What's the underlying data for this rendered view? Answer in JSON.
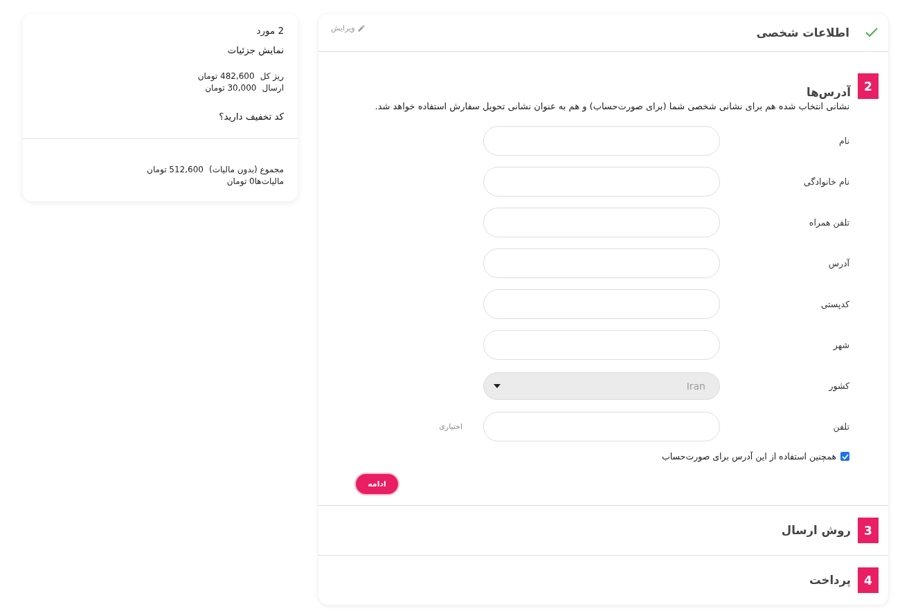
{
  "summary": {
    "items_count": "2 مورد",
    "details_link": "نمایش جزئیات",
    "lines": [
      {
        "label": "ریز کل",
        "value": "482,600 تومان"
      },
      {
        "label": "ارسال",
        "value": "30,000 تومان"
      }
    ],
    "coupon_link": "کد تخفیف دارید؟",
    "totals": [
      {
        "label": "مجموع (بدون مالیات)",
        "value": "512,600 تومان"
      },
      {
        "label": "مالیات‌ها",
        "value": "0 تومان"
      }
    ]
  },
  "steps": [
    {
      "kind": "done",
      "title": "اطلاعات شخصی",
      "edit": "ویرایش"
    },
    {
      "kind": "active",
      "number": "2",
      "title": "آدرس‌ها",
      "description": "نشانی انتخاب شده هم برای نشانی شخصی شما (برای صورت‌حساب) و هم به عنوان نشانی تحویل سفارش استفاده خواهد شد.",
      "fields": [
        {
          "kind": "text",
          "label": "نام"
        },
        {
          "kind": "text",
          "label": "نام خانوادگی"
        },
        {
          "kind": "text",
          "label": "تلفن همراه"
        },
        {
          "kind": "text",
          "label": "آدرس"
        },
        {
          "kind": "text",
          "label": "کدپستی"
        },
        {
          "kind": "text",
          "label": "شهر"
        },
        {
          "kind": "select",
          "label": "کشور",
          "value": "Iran"
        },
        {
          "kind": "text",
          "label": "تلفن",
          "hint": "اختیاری"
        }
      ],
      "checkbox": {
        "label": "همچنین استفاده از این آدرس برای صورت‌حساب",
        "checked": true
      },
      "button": "ادامه"
    },
    {
      "kind": "collapsed",
      "number": "3",
      "title": "روش ارسال"
    },
    {
      "kind": "collapsed",
      "number": "4",
      "title": "پرداخت"
    }
  ]
}
